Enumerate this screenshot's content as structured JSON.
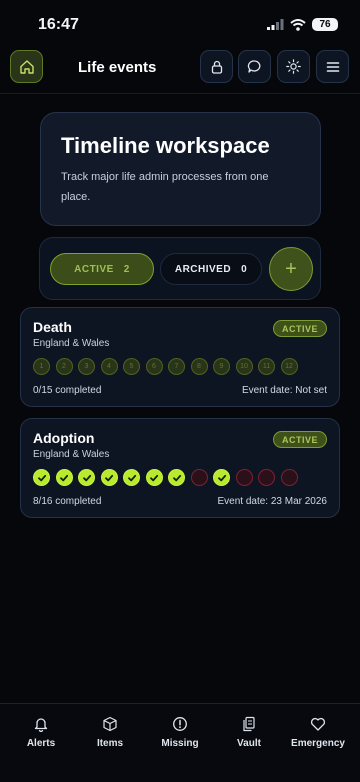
{
  "status_bar": {
    "time": "16:47",
    "battery": "76"
  },
  "header": {
    "title": "Life events"
  },
  "hero": {
    "title": "Timeline workspace",
    "subtitle": "Track major life admin processes from one place."
  },
  "filters": {
    "active_label": "ACTIVE",
    "active_count": "2",
    "archived_label": "ARCHIVED",
    "archived_count": "0",
    "add_symbol": "+"
  },
  "events": [
    {
      "title": "Death",
      "region": "England & Wales",
      "badge": "ACTIVE",
      "steps": [
        {
          "label": "1",
          "state": "pending"
        },
        {
          "label": "2",
          "state": "pending"
        },
        {
          "label": "3",
          "state": "pending"
        },
        {
          "label": "4",
          "state": "pending"
        },
        {
          "label": "5",
          "state": "pending"
        },
        {
          "label": "6",
          "state": "pending"
        },
        {
          "label": "7",
          "state": "pending"
        },
        {
          "label": "8",
          "state": "pending"
        },
        {
          "label": "9",
          "state": "pending"
        },
        {
          "label": "10",
          "state": "pending"
        },
        {
          "label": "11",
          "state": "pending"
        },
        {
          "label": "12",
          "state": "pending"
        }
      ],
      "progress": "0/15 completed",
      "event_date": "Event date: Not set"
    },
    {
      "title": "Adoption",
      "region": "England & Wales",
      "badge": "ACTIVE",
      "steps": [
        {
          "label": "",
          "state": "done"
        },
        {
          "label": "",
          "state": "done"
        },
        {
          "label": "",
          "state": "done"
        },
        {
          "label": "",
          "state": "done"
        },
        {
          "label": "",
          "state": "done"
        },
        {
          "label": "",
          "state": "done"
        },
        {
          "label": "",
          "state": "done"
        },
        {
          "label": "",
          "state": "blocked"
        },
        {
          "label": "",
          "state": "done"
        },
        {
          "label": "",
          "state": "blocked"
        },
        {
          "label": "",
          "state": "blocked"
        },
        {
          "label": "",
          "state": "blocked"
        }
      ],
      "progress": "8/16 completed",
      "event_date": "Event date: 23 Mar 2026"
    }
  ],
  "bottom_nav": [
    {
      "label": "Alerts",
      "icon": "bell-icon"
    },
    {
      "label": "Items",
      "icon": "cube-icon"
    },
    {
      "label": "Missing",
      "icon": "alert-circle-icon"
    },
    {
      "label": "Vault",
      "icon": "documents-icon"
    },
    {
      "label": "Emergency",
      "icon": "heart-icon"
    }
  ],
  "colors": {
    "accent": "#b8ea2e",
    "accent_dark": "#3f5119",
    "danger": "#7c2232",
    "background": "#05070b",
    "card": "#0d1522"
  }
}
